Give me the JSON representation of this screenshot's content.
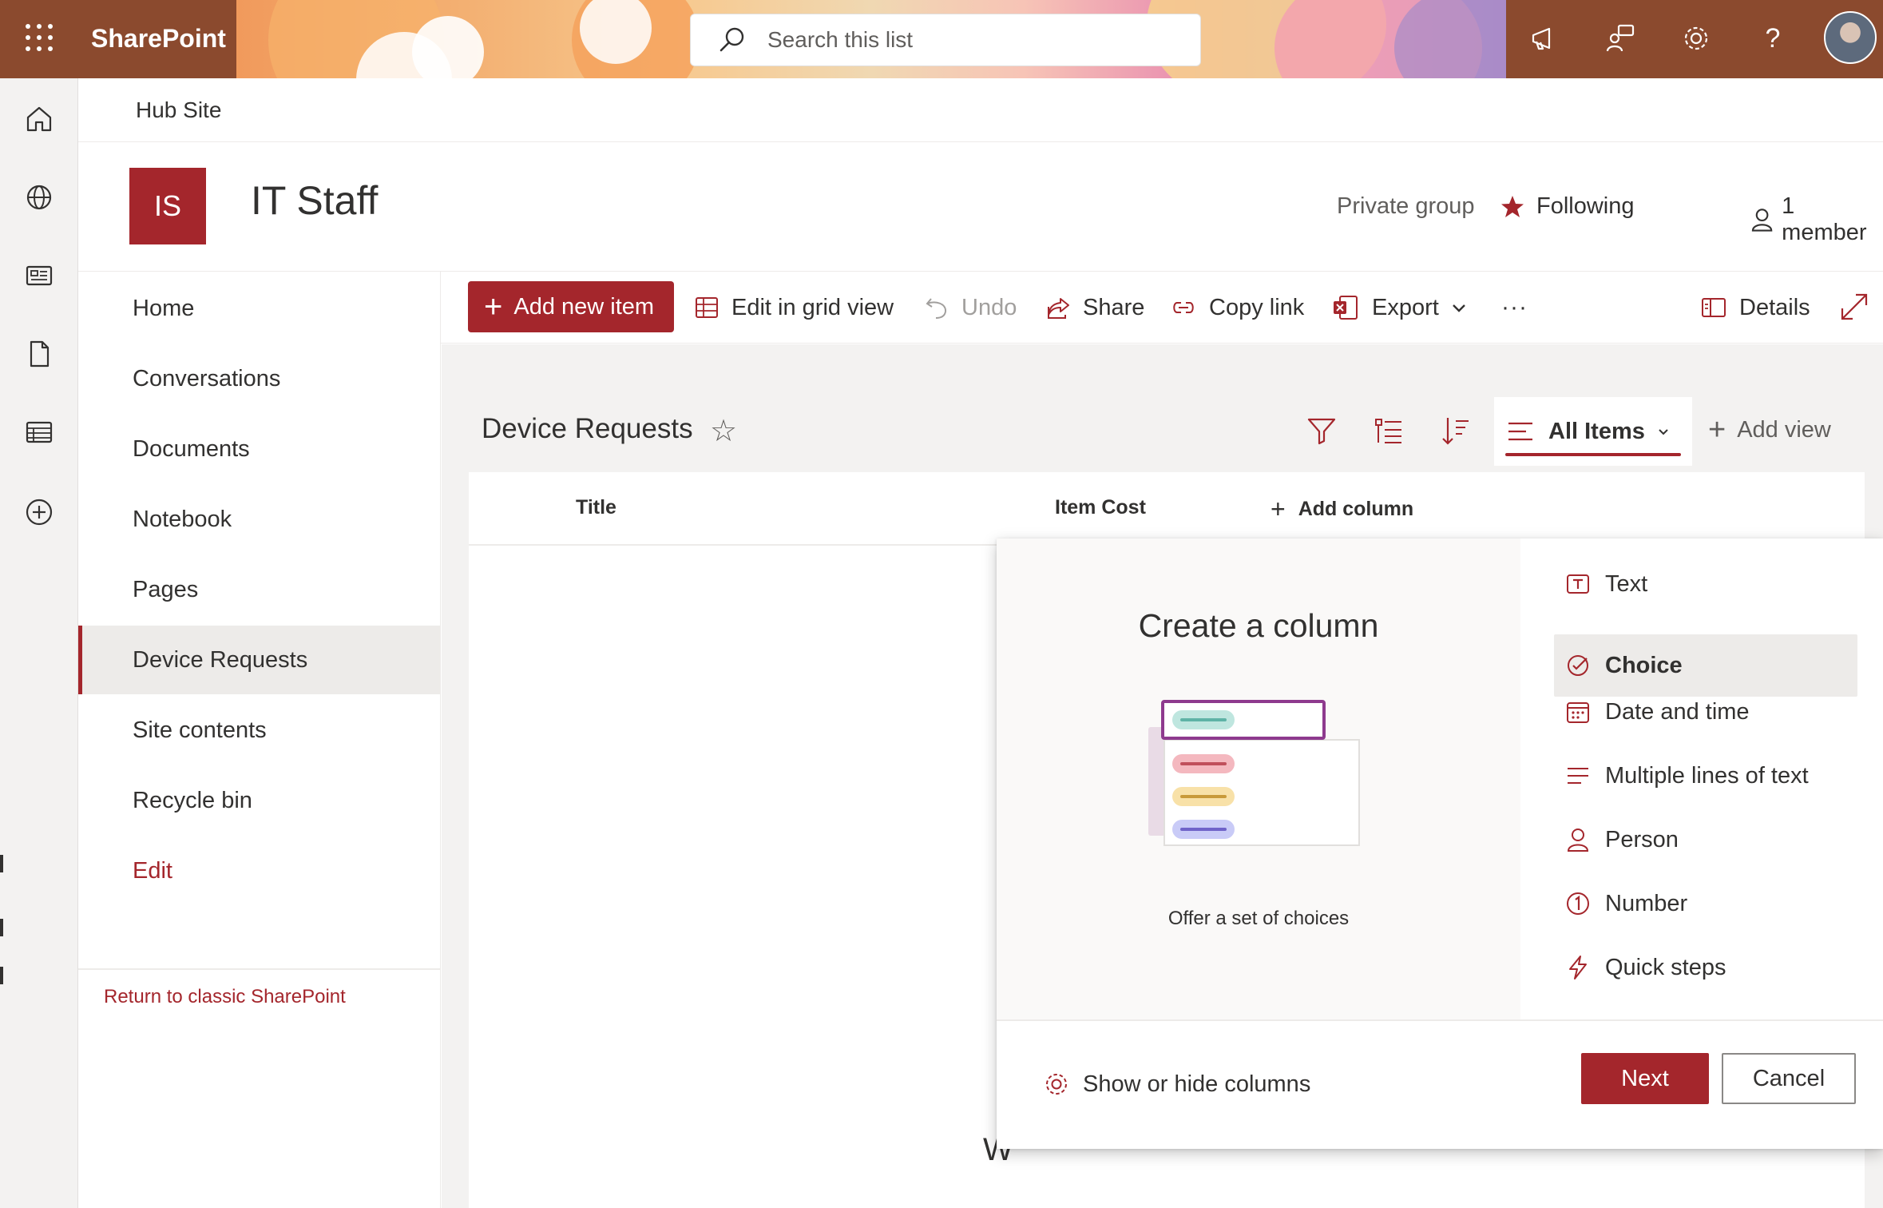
{
  "suite": {
    "brand": "SharePoint",
    "search_placeholder": "Search this list"
  },
  "hub": {
    "title": "Hub Site"
  },
  "site": {
    "logo_initials": "IS",
    "title": "IT Staff",
    "privacy": "Private group",
    "follow_label": "Following",
    "members_label": "1 member"
  },
  "nav": {
    "items": [
      {
        "label": "Home"
      },
      {
        "label": "Conversations"
      },
      {
        "label": "Documents"
      },
      {
        "label": "Notebook"
      },
      {
        "label": "Pages"
      },
      {
        "label": "Device Requests",
        "selected": true
      },
      {
        "label": "Site contents"
      },
      {
        "label": "Recycle bin"
      },
      {
        "label": "Edit"
      }
    ],
    "classic_link": "Return to classic SharePoint"
  },
  "commands": {
    "add_new_item": "Add new item",
    "edit_grid": "Edit in grid view",
    "undo": "Undo",
    "share": "Share",
    "copy_link": "Copy link",
    "export": "Export",
    "more": "···",
    "details": "Details"
  },
  "list": {
    "title": "Device Requests",
    "view_name": "All Items",
    "add_view": "Add view",
    "columns": [
      {
        "label": "Title"
      },
      {
        "label": "Item Cost"
      }
    ],
    "add_column": "Add column",
    "ghost_text": "W"
  },
  "panel": {
    "title": "Create a column",
    "description": "Offer a set of choices",
    "types": [
      {
        "label": "Text",
        "icon": "text-box-icon"
      },
      {
        "label": "Choice",
        "icon": "check-circle-icon",
        "selected": true
      },
      {
        "label": "Date and time",
        "icon": "calendar-icon"
      },
      {
        "label": "Multiple lines of text",
        "icon": "lines-icon"
      },
      {
        "label": "Person",
        "icon": "person-icon"
      },
      {
        "label": "Number",
        "icon": "number-circle-icon"
      },
      {
        "label": "Quick steps",
        "icon": "lightning-icon"
      }
    ],
    "show_hide": "Show or hide columns",
    "next": "Next",
    "cancel": "Cancel"
  },
  "colors": {
    "accent": "#a4262c",
    "suite_bar": "#8b4a2e",
    "neutral_bg": "#f3f2f1",
    "choice_teal": "#7fcbc0",
    "choice_pink": "#e88a95",
    "choice_yellow": "#f2cf78",
    "choice_purple": "#a5a8f0"
  }
}
